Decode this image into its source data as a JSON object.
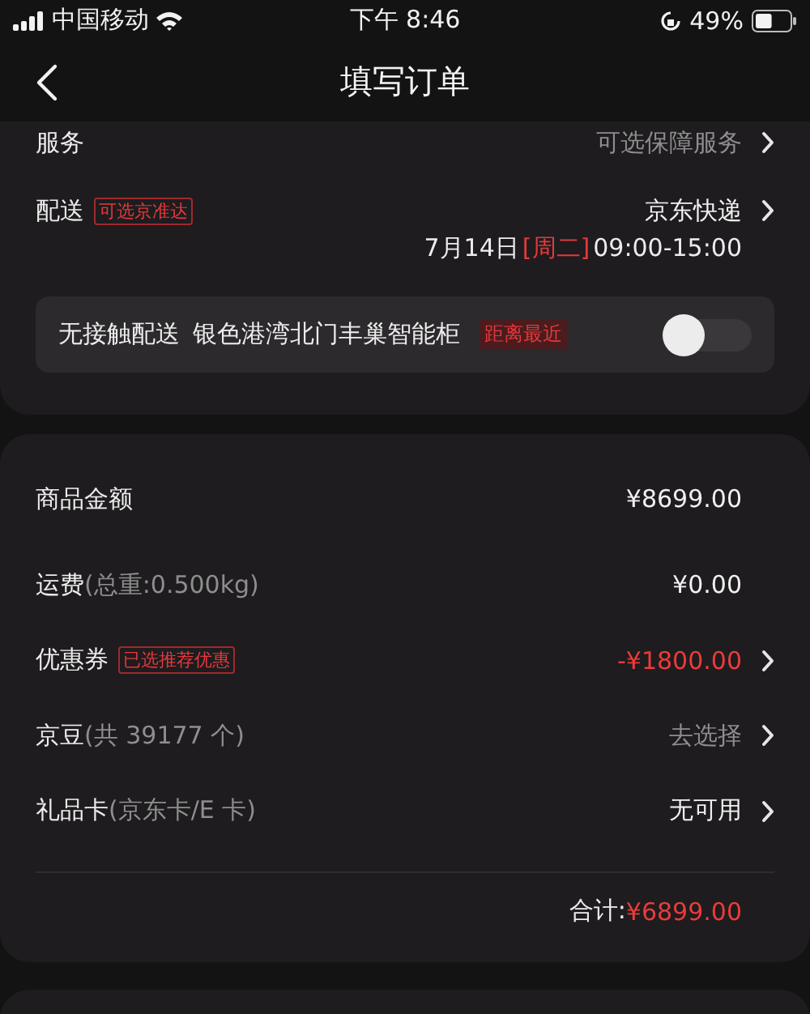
{
  "status_bar": {
    "carrier": "中国移动",
    "time": "下午 8:46",
    "battery": "49%"
  },
  "nav": {
    "title": "填写订单"
  },
  "delivery_card": {
    "service": {
      "label": "服务",
      "value": "可选保障服务",
      "chevron": true
    },
    "delivery": {
      "label": "配送",
      "tag": "可选京准达",
      "value": "京东快递",
      "chevron": true,
      "date": "7月14日",
      "weekday": "[周二]",
      "time": "09:00-15:00"
    },
    "contactless": {
      "label": "无接触配送",
      "location": "银色港湾北门丰巢智能柜",
      "tag": "距离最近",
      "on": false
    }
  },
  "summary_card": {
    "rows": [
      {
        "label": "商品金额",
        "value": "¥8699.00",
        "kind": "plain",
        "chevron": false
      },
      {
        "label": "运费",
        "note": "(总重:0.500kg)",
        "value": "¥0.00",
        "kind": "plain",
        "chevron": false
      },
      {
        "label": "优惠券",
        "tag": "已选推荐优惠",
        "value": "-¥1800.00",
        "kind": "discount",
        "chevron": true
      },
      {
        "label": "京豆",
        "note": "(共 39177 个)",
        "value": "去选择",
        "kind": "link",
        "chevron": true
      },
      {
        "label": "礼品卡",
        "note": "(京东卡/E 卡)",
        "value": "无可用",
        "kind": "plain",
        "chevron": true
      }
    ],
    "total": {
      "label": "合计:",
      "amount": "¥6899.00"
    }
  }
}
